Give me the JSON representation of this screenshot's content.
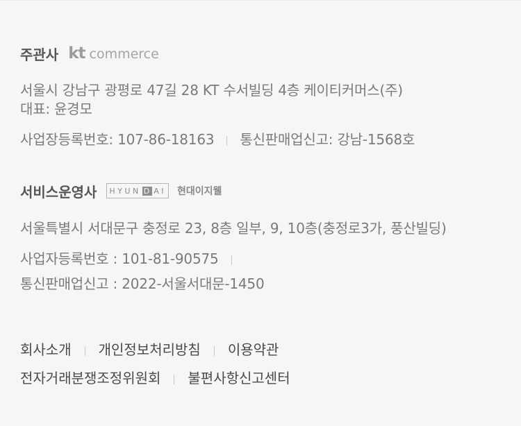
{
  "operator": {
    "label": "주관사",
    "logo_kt": "kt",
    "logo_commerce": "commerce",
    "address": "서울시 강남구 광평로 47길 28 KT 수서빌딩 4층 케이티커머스(주)",
    "ceo": "대표: 윤경모",
    "business_reg": "사업장등록번호: 107-86-18163",
    "mail_order_reg": "통신판매업신고: 강남-1568호"
  },
  "service": {
    "label": "서비스운영사",
    "logo_hyundai": [
      "H",
      "Y",
      "U",
      "N",
      "D",
      "A",
      "I"
    ],
    "logo_sub": "현대이지웰",
    "address": "서울특별시 서대문구 충정로 23, 8층 일부, 9, 10층(충정로3가, 풍산빌딩)",
    "business_reg": "사업자등록번호 : 101-81-90575",
    "mail_order_reg": "통신판매업신고 : 2022-서울서대문-1450"
  },
  "links": {
    "company": "회사소개",
    "privacy": "개인정보처리방침",
    "terms": "이용약관",
    "dispute": "전자거래분쟁조정위원회",
    "complaint": "불편사항신고센터"
  }
}
